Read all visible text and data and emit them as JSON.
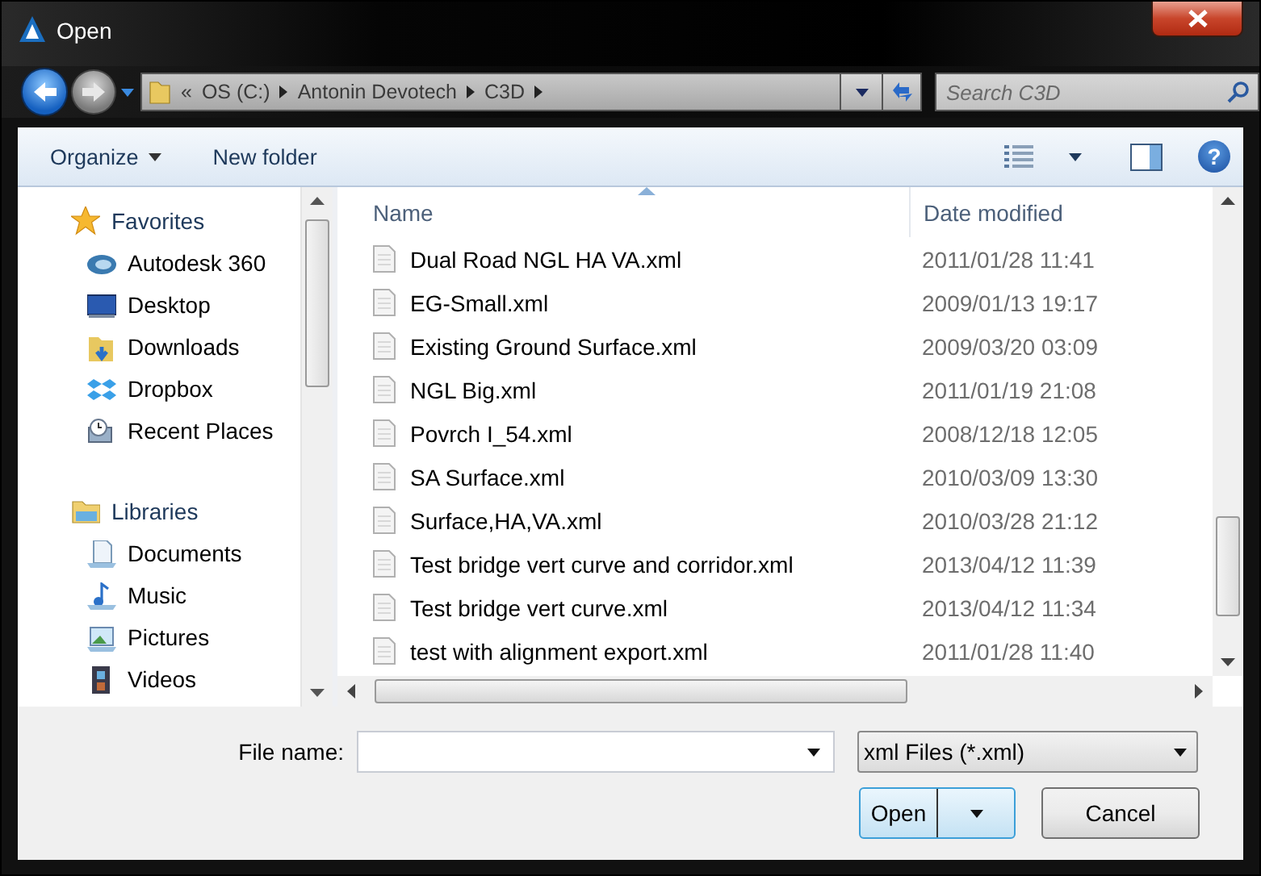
{
  "window": {
    "title": "Open"
  },
  "navigation": {
    "address": [
      "«",
      "OS (C:)",
      "Antonin Devotech",
      "C3D"
    ],
    "search": {
      "placeholder": "Search C3D"
    }
  },
  "toolbar": {
    "organize": "Organize",
    "new_folder": "New folder",
    "help": "?"
  },
  "sidebar": {
    "groups": [
      {
        "label": "Favorites",
        "items": [
          "Autodesk 360",
          "Desktop",
          "Downloads",
          "Dropbox",
          "Recent Places"
        ]
      },
      {
        "label": "Libraries",
        "items": [
          "Documents",
          "Music",
          "Pictures",
          "Videos"
        ]
      }
    ]
  },
  "file_list": {
    "columns": [
      "Name",
      "Date modified"
    ],
    "rows": [
      {
        "name": "Dual Road NGL HA VA.xml",
        "date_modified": "2011/01/28 11:41"
      },
      {
        "name": "EG-Small.xml",
        "date_modified": "2009/01/13 19:17"
      },
      {
        "name": "Existing Ground Surface.xml",
        "date_modified": "2009/03/20 03:09"
      },
      {
        "name": "NGL Big.xml",
        "date_modified": "2011/01/19 21:08"
      },
      {
        "name": "Povrch I_54.xml",
        "date_modified": "2008/12/18 12:05"
      },
      {
        "name": "SA Surface.xml",
        "date_modified": "2010/03/09 13:30"
      },
      {
        "name": "Surface,HA,VA.xml",
        "date_modified": "2010/03/28 21:12"
      },
      {
        "name": "Test bridge vert curve and corridor.xml",
        "date_modified": "2013/04/12 11:39"
      },
      {
        "name": "Test bridge vert curve.xml",
        "date_modified": "2013/04/12 11:34"
      },
      {
        "name": "test with alignment export.xml",
        "date_modified": "2011/01/28 11:40"
      }
    ]
  },
  "footer": {
    "file_name_label": "File name:",
    "file_type": "xml Files (*.xml)",
    "buttons": [
      "Open",
      "Cancel"
    ]
  }
}
